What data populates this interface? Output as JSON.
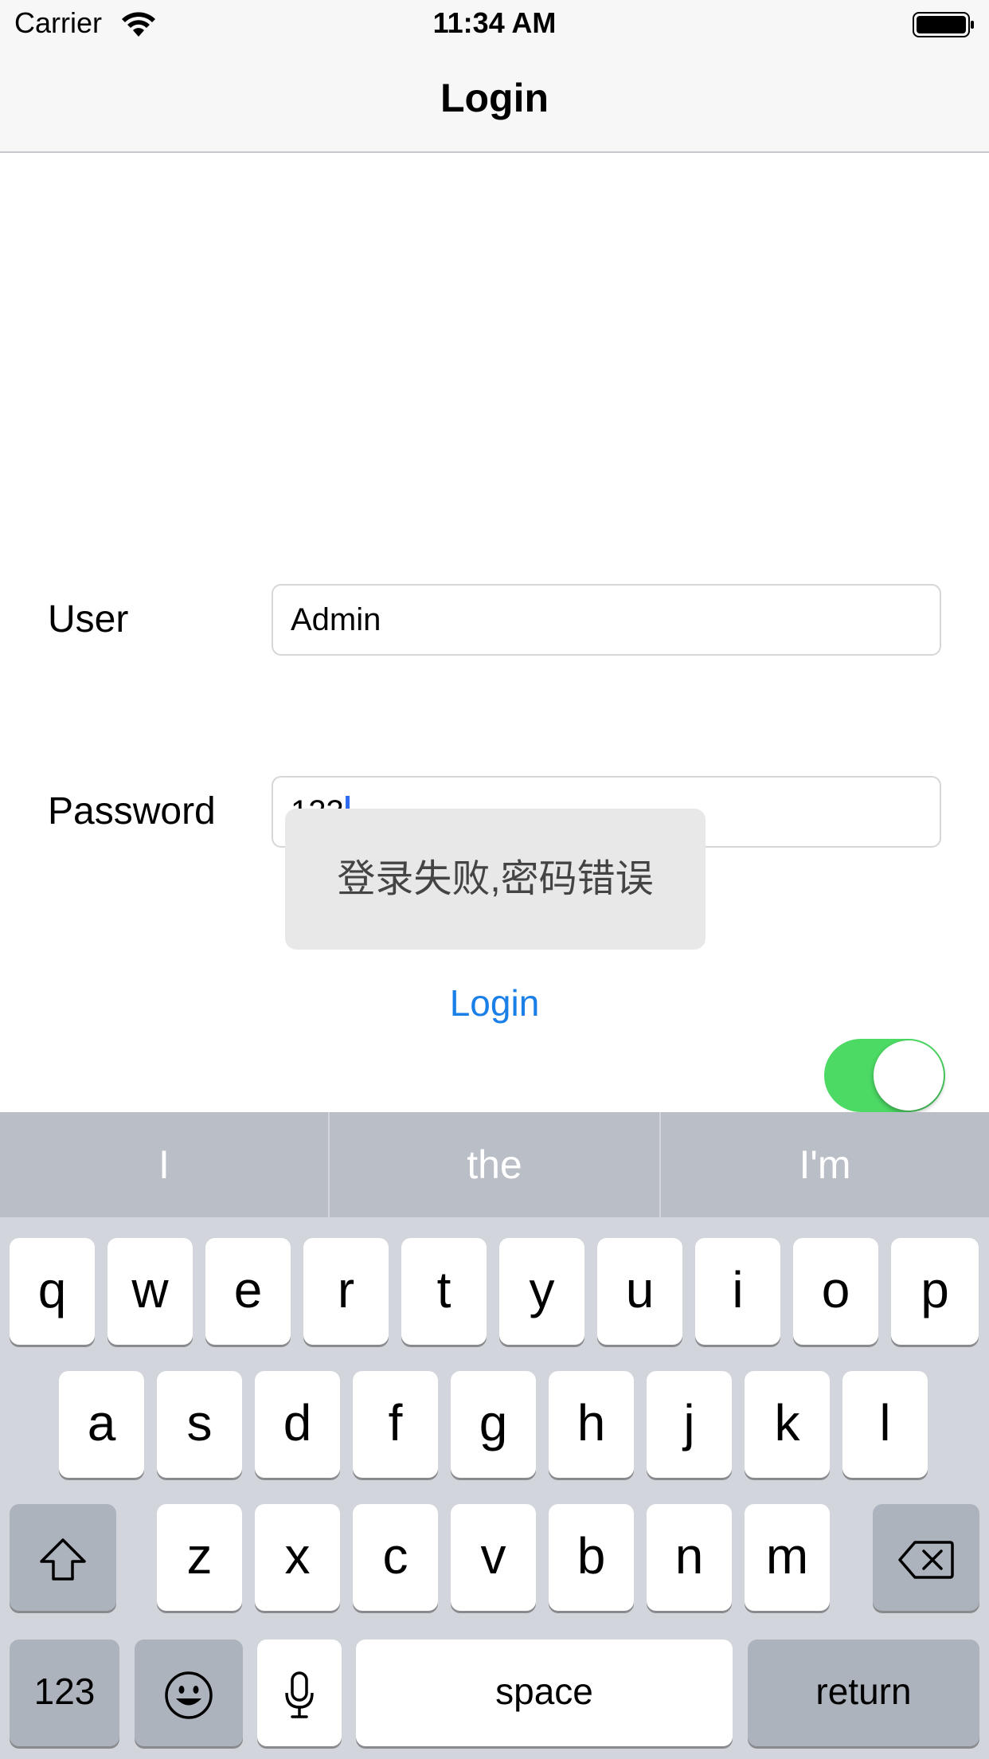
{
  "status_bar": {
    "carrier": "Carrier",
    "time": "11:34 AM"
  },
  "nav": {
    "title": "Login"
  },
  "form": {
    "user_label": "User",
    "user_value": "Admin",
    "password_label": "Password",
    "password_value": "123"
  },
  "toast": {
    "message": "登录失败,密码错误"
  },
  "login_button": "Login",
  "toggle": {
    "on": true,
    "color": "#4cd964"
  },
  "keyboard": {
    "predictions": [
      "I",
      "the",
      "I'm"
    ],
    "row1": [
      "q",
      "w",
      "e",
      "r",
      "t",
      "y",
      "u",
      "i",
      "o",
      "p"
    ],
    "row2": [
      "a",
      "s",
      "d",
      "f",
      "g",
      "h",
      "j",
      "k",
      "l"
    ],
    "row3": [
      "z",
      "x",
      "c",
      "v",
      "b",
      "n",
      "m"
    ],
    "numbers_key": "123",
    "space_key": "space",
    "return_key": "return"
  }
}
